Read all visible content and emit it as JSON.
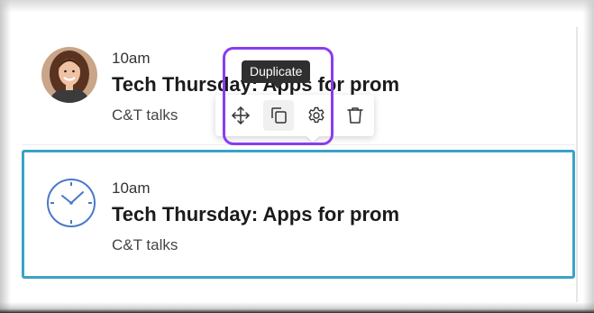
{
  "events": [
    {
      "time": "10am",
      "title": "Tech Thursday: Apps for prom",
      "category": "C&T talks",
      "leading": "avatar",
      "selected": false
    },
    {
      "time": "10am",
      "title": "Tech Thursday: Apps for prom",
      "category": "C&T talks",
      "leading": "clock-icon",
      "selected": true
    }
  ],
  "toolbar": {
    "buttons": [
      {
        "icon": "move-icon",
        "label": "Move"
      },
      {
        "icon": "duplicate-icon",
        "label": "Duplicate"
      },
      {
        "icon": "gear-icon",
        "label": "Settings"
      },
      {
        "icon": "trash-icon",
        "label": "Delete"
      }
    ],
    "tooltip": "Duplicate",
    "active_button": "duplicate"
  },
  "colors": {
    "selected_border": "#3aa3c9",
    "highlight_annotation": "#8a3cf0",
    "clock_icon": "#4a78c9",
    "tooltip_bg": "#2f2f2f"
  }
}
